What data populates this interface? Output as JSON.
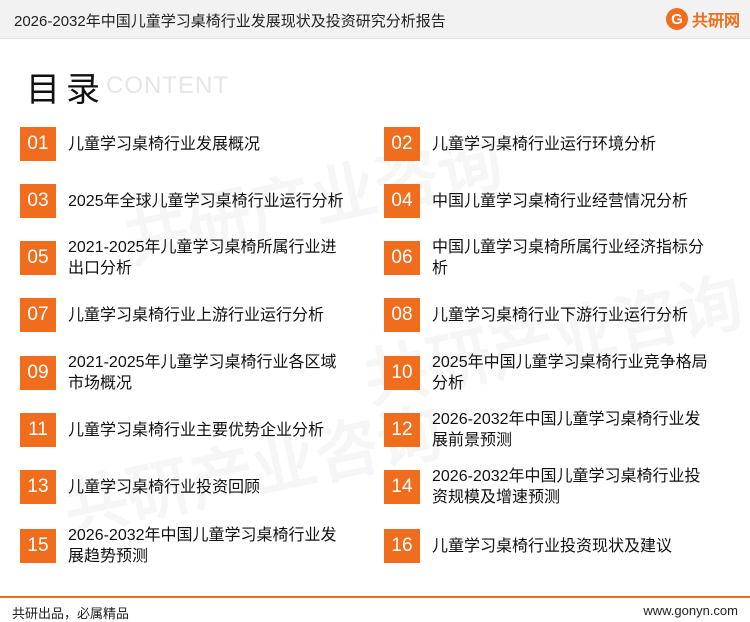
{
  "header": {
    "title": "2026-2032年中国儿童学习桌椅行业发展现状及投资研究分析报告",
    "logo_mark": "G",
    "logo_text": "共研网"
  },
  "toc": {
    "title": "目录",
    "subtitle": "CONTENT",
    "items": [
      {
        "num": "01",
        "label": "儿童学习桌椅行业发展概况"
      },
      {
        "num": "02",
        "label": "儿童学习桌椅行业运行环境分析"
      },
      {
        "num": "03",
        "label": "2025年全球儿童学习桌椅行业运行分析"
      },
      {
        "num": "04",
        "label": "中国儿童学习桌椅行业经营情况分析"
      },
      {
        "num": "05",
        "label": "2021-2025年儿童学习桌椅所属行业进出口分析"
      },
      {
        "num": "06",
        "label": "中国儿童学习桌椅所属行业经济指标分析"
      },
      {
        "num": "07",
        "label": "儿童学习桌椅行业上游行业运行分析"
      },
      {
        "num": "08",
        "label": "儿童学习桌椅行业下游行业运行分析"
      },
      {
        "num": "09",
        "label": "2021-2025年儿童学习桌椅行业各区域市场概况"
      },
      {
        "num": "10",
        "label": "2025年中国儿童学习桌椅行业竞争格局分析"
      },
      {
        "num": "11",
        "label": "儿童学习桌椅行业主要优势企业分析"
      },
      {
        "num": "12",
        "label": "2026-2032年中国儿童学习桌椅行业发展前景预测"
      },
      {
        "num": "13",
        "label": "儿童学习桌椅行业投资回顾"
      },
      {
        "num": "14",
        "label": "2026-2032年中国儿童学习桌椅行业投资规模及增速预测"
      },
      {
        "num": "15",
        "label": "2026-2032年中国儿童学习桌椅行业发展趋势预测"
      },
      {
        "num": "16",
        "label": "儿童学习桌椅行业投资现状及建议"
      }
    ]
  },
  "watermark": {
    "text": "共研产业咨询",
    "site": "www.gonyn.com"
  },
  "footer": {
    "slogan": "共研出品，必属精品",
    "url": "www.gonyn.com"
  },
  "colors": {
    "accent": "#f06d1d",
    "header_bg": "#f2f2f2"
  }
}
